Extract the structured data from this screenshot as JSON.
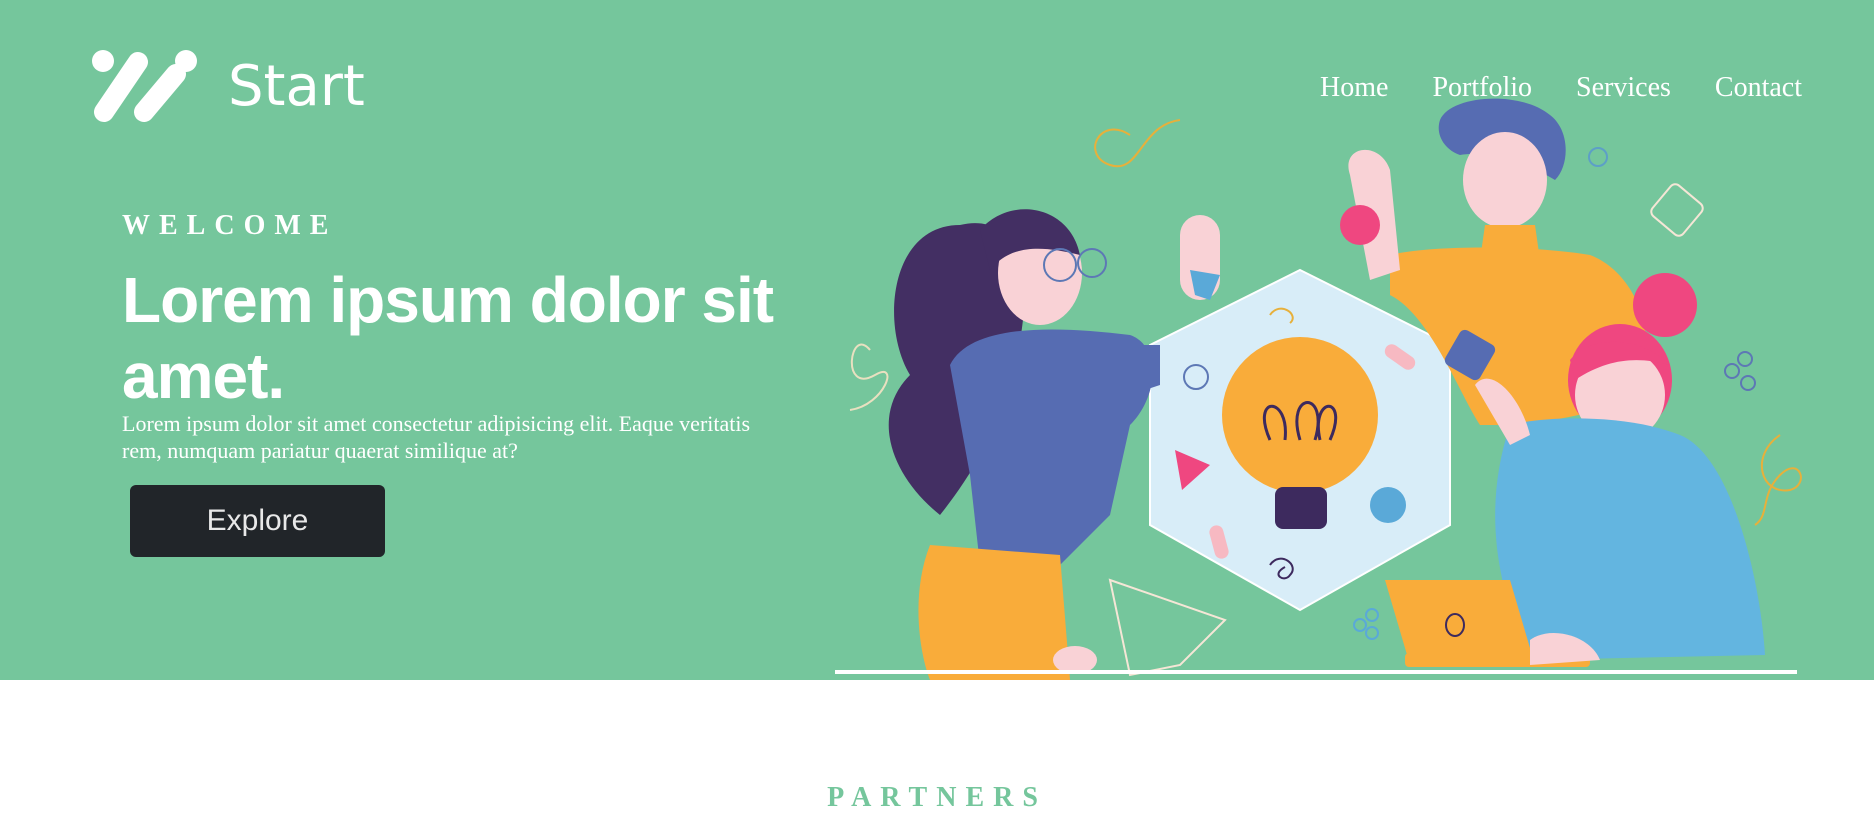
{
  "brand": {
    "name": "Start",
    "icon": "logo-slashes-icon"
  },
  "nav": {
    "items": [
      "Home",
      "Portfolio",
      "Services",
      "Contact"
    ]
  },
  "hero": {
    "eyebrow": "WELCOME",
    "title": "Lorem ipsum dolor sit amet.",
    "description": "Lorem ipsum dolor sit amet consectetur adipisicing elit. Eaque veritatis rem, numquam pariatur quaerat similique at?",
    "cta_label": "Explore",
    "illustration": "team-brainstorm-lightbulb-illustration"
  },
  "partners": {
    "heading": "PARTNERS"
  },
  "colors": {
    "hero_bg": "#75c69c",
    "button_bg": "#212529",
    "accent": "#75c69c",
    "white": "#ffffff"
  }
}
